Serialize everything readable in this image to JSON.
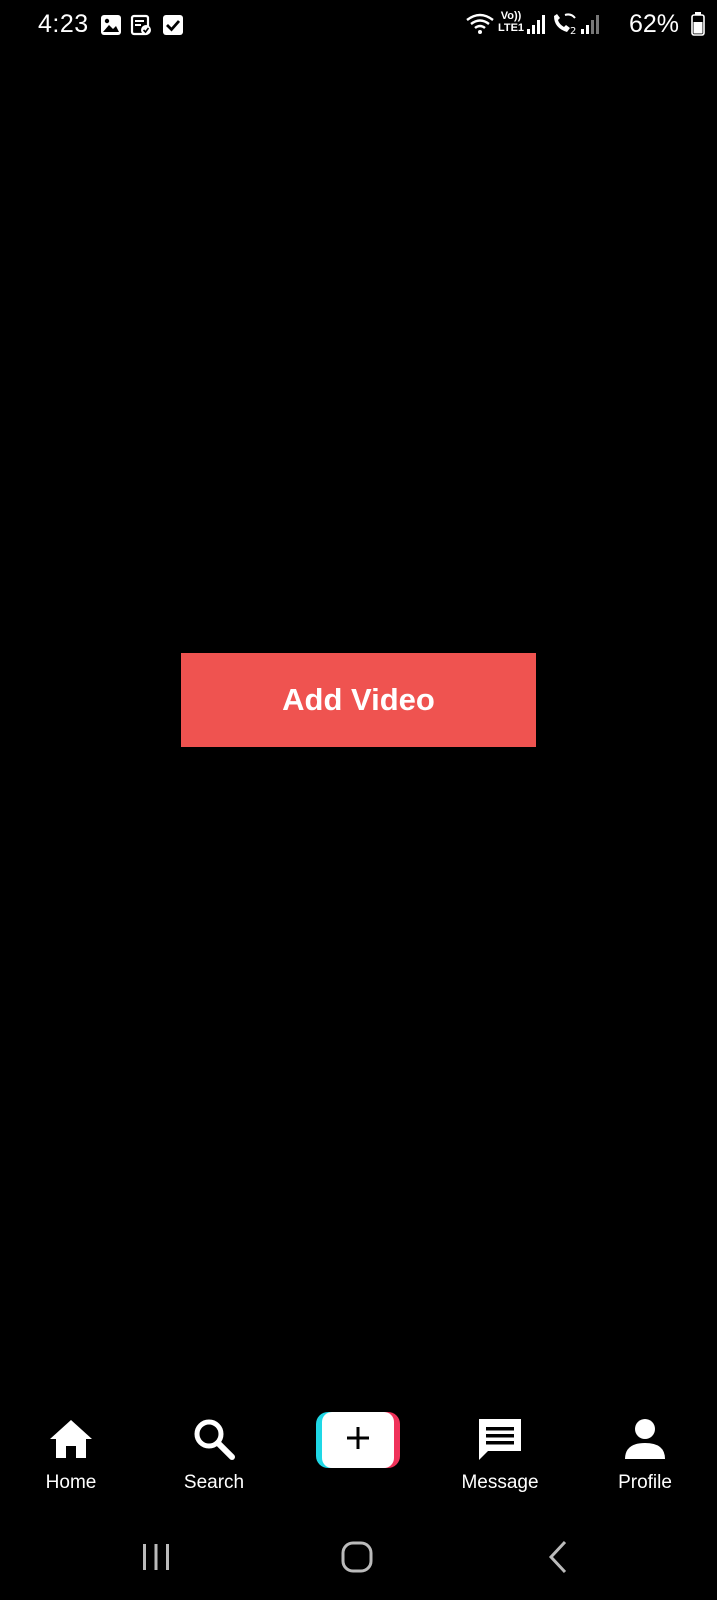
{
  "status_bar": {
    "time": "4:23",
    "battery_percent": "62%",
    "network_label_top": "Vo))",
    "network_label_bottom": "LTE1",
    "notification_icons": [
      "gallery-icon",
      "clipboard-check-icon",
      "checkbox-icon"
    ],
    "status_icons": [
      "wifi-icon",
      "signal-icon",
      "wifi-calling-icon",
      "signal-icon",
      "battery-icon"
    ]
  },
  "main": {
    "add_video_label": "Add Video",
    "accent_color": "#ef5350"
  },
  "bottom_nav": {
    "items": [
      {
        "label": "Home",
        "icon": "home-icon"
      },
      {
        "label": "Search",
        "icon": "search-icon"
      },
      {
        "label": "",
        "icon": "plus-icon"
      },
      {
        "label": "Message",
        "icon": "message-icon"
      },
      {
        "label": "Profile",
        "icon": "profile-icon"
      }
    ],
    "create_colors": {
      "left": "#1fd8e6",
      "right": "#f0325a"
    }
  },
  "system_nav": {
    "icons": [
      "recent-apps-icon",
      "home-button-icon",
      "back-icon"
    ]
  }
}
